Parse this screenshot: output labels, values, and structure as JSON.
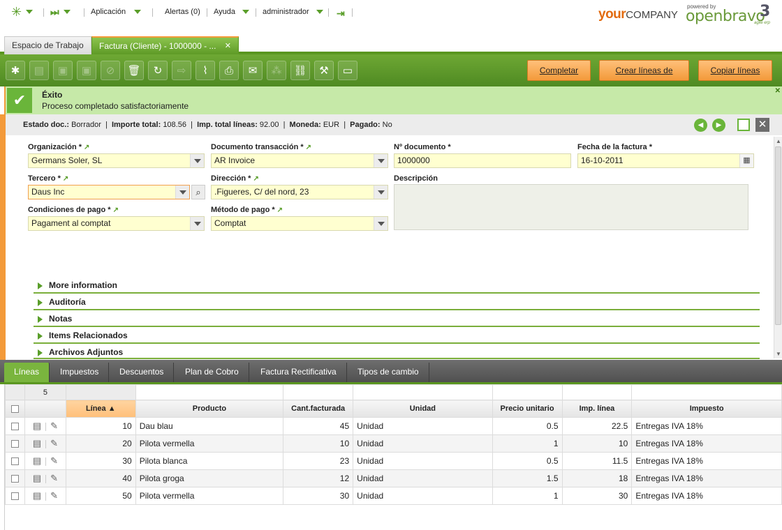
{
  "topbar": {
    "app_menu": "Aplicación",
    "alerts": "Alertas (0)",
    "help": "Ayuda",
    "user": "administrador",
    "brand_your": "your",
    "brand_company": "COMPANY",
    "powered_by": "powered by",
    "openbravo": "openbravo",
    "openbravo_version": "3",
    "agile_erp": "agile erp"
  },
  "window_tabs": [
    {
      "label": "Espacio de Trabajo"
    },
    {
      "label": "Factura (Cliente) - 1000000 - ..."
    }
  ],
  "toolbar": {
    "complete_label": "Completar",
    "create_lines_label": "Crear líneas de",
    "copy_lines_label": "Copiar líneas"
  },
  "message": {
    "title": "Éxito",
    "text": "Proceso completado satisfactoriamente"
  },
  "status": {
    "doc_state_label": "Estado doc.:",
    "doc_state": "Borrador",
    "total_label": "Importe total:",
    "total": "108.56",
    "lines_total_label": "Imp. total líneas:",
    "lines_total": "92.00",
    "currency_label": "Moneda:",
    "currency": "EUR",
    "paid_label": "Pagado:",
    "paid": "No"
  },
  "form": {
    "organization_label": "Organización *",
    "organization": "Germans Soler, SL",
    "doc_type_label": "Documento transacción *",
    "doc_type": "AR Invoice",
    "doc_no_label": "Nº documento *",
    "doc_no": "1000000",
    "invoice_date_label": "Fecha de la factura *",
    "invoice_date": "16-10-2011",
    "partner_label": "Tercero *",
    "partner": "Daus Inc",
    "address_label": "Dirección *",
    "address": ".Figueres, C/ del nord, 23",
    "description_label": "Descripción",
    "description": "",
    "payment_terms_label": "Condiciones de pago *",
    "payment_terms": "Pagament al comptat",
    "payment_method_label": "Método de pago *",
    "payment_method": "Comptat"
  },
  "sections": [
    {
      "label": "More information"
    },
    {
      "label": "Auditoría"
    },
    {
      "label": "Notas"
    },
    {
      "label": "Items Relacionados"
    },
    {
      "label": "Archivos Adjuntos"
    }
  ],
  "lower_tabs": [
    {
      "label": "Líneas"
    },
    {
      "label": "Impuestos"
    },
    {
      "label": "Descuentos"
    },
    {
      "label": "Plan de Cobro"
    },
    {
      "label": "Factura Rectificativa"
    },
    {
      "label": "Tipos de cambio"
    }
  ],
  "grid": {
    "row_count": "5",
    "columns": [
      "Línea ▲",
      "Producto",
      "Cant.facturada",
      "Unidad",
      "Precio unitario",
      "Imp. línea",
      "Impuesto"
    ],
    "rows": [
      {
        "line": "10",
        "product": "Dau blau",
        "qty": "45",
        "unit": "Unidad",
        "price": "0.5",
        "amount": "22.5",
        "tax": "Entregas IVA 18%"
      },
      {
        "line": "20",
        "product": "Pilota vermella",
        "qty": "10",
        "unit": "Unidad",
        "price": "1",
        "amount": "10",
        "tax": "Entregas IVA 18%"
      },
      {
        "line": "30",
        "product": "Pilota blanca",
        "qty": "23",
        "unit": "Unidad",
        "price": "0.5",
        "amount": "11.5",
        "tax": "Entregas IVA 18%"
      },
      {
        "line": "40",
        "product": "Pilota groga",
        "qty": "12",
        "unit": "Unidad",
        "price": "1.5",
        "amount": "18",
        "tax": "Entregas IVA 18%"
      },
      {
        "line": "50",
        "product": "Pilota vermella",
        "qty": "30",
        "unit": "Unidad",
        "price": "1",
        "amount": "30",
        "tax": "Entregas IVA 18%"
      }
    ]
  },
  "colors": {
    "accent_green": "#5a9620",
    "orange": "#f39a3a",
    "success_bg": "#c6e9a8"
  },
  "icons": [
    "star-icon",
    "forward-icon",
    "logout-icon",
    "new-icon",
    "grid-icon",
    "save-icon",
    "save-close-icon",
    "undo-icon",
    "delete-icon",
    "refresh-icon",
    "export-icon",
    "attach-icon",
    "print-icon",
    "email-icon",
    "audit-icon",
    "link-icon",
    "tools-icon",
    "layout-icon"
  ]
}
